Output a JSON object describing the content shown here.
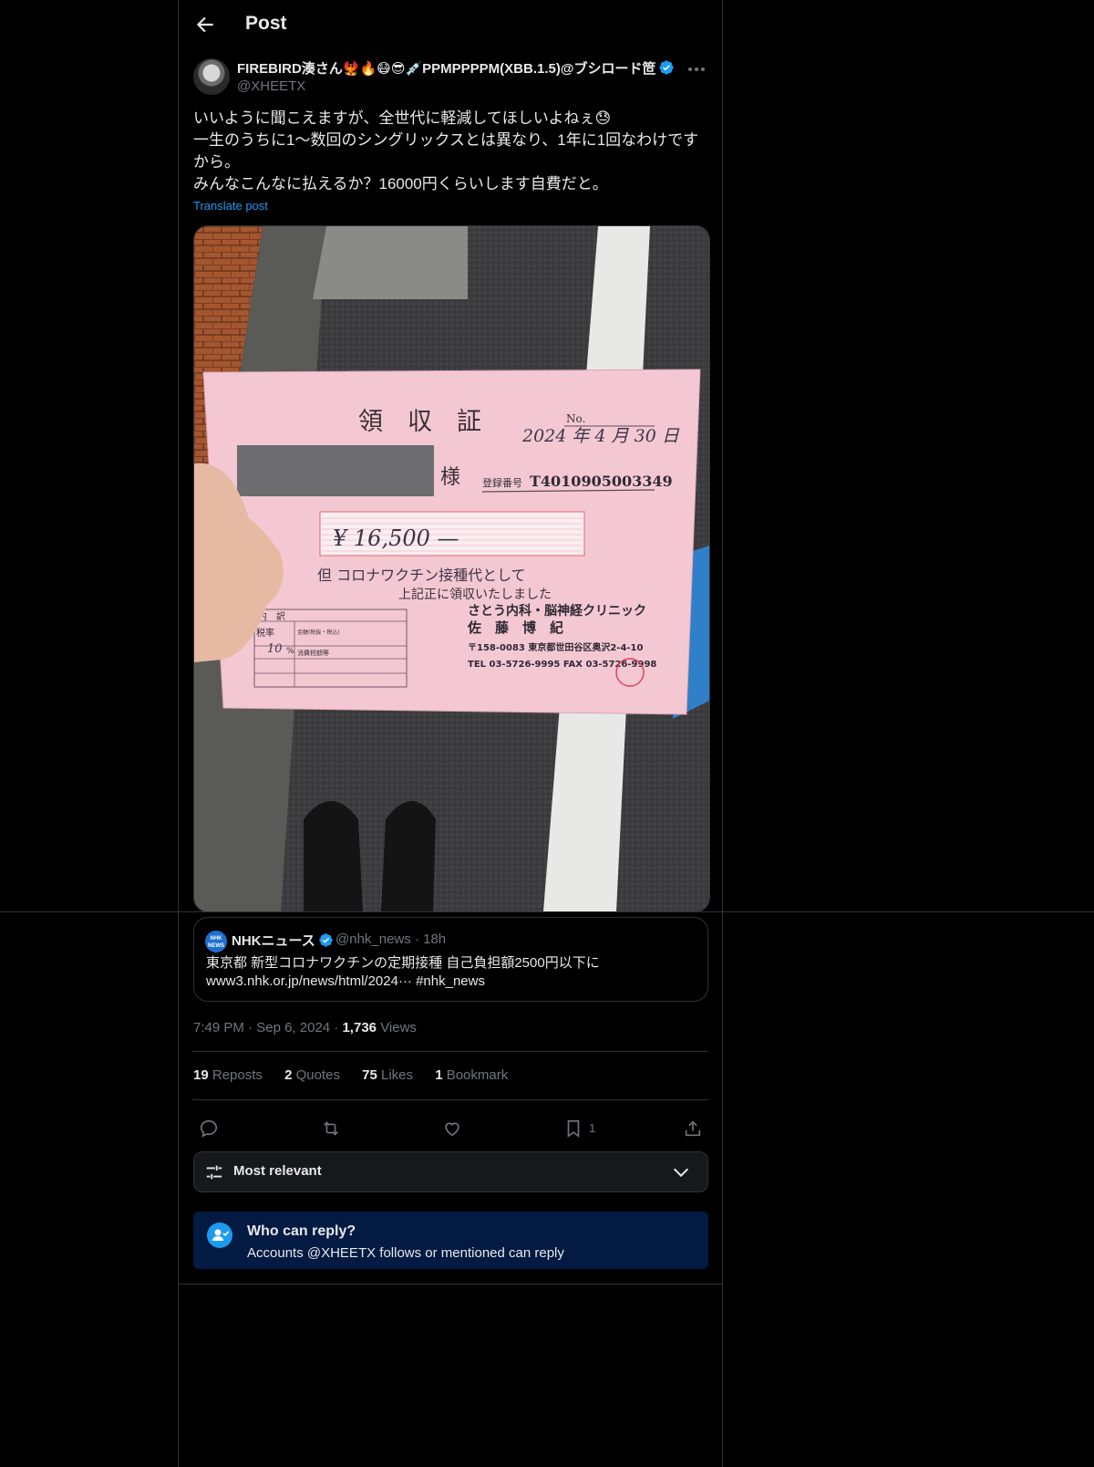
{
  "header": {
    "title": "Post"
  },
  "author": {
    "name": "FIREBIRD湊さん🐦‍🔥🔥😷😎💉PPMPPPPM(XBB.1.5)@ブシロード笸",
    "handle": "@XHEETX"
  },
  "post": {
    "lines": [
      "いいように聞こえますが、全世代に軽減してほしいよねぇ😓",
      "一生のうちに1〜数回のシングリックスとは異なり、1年に1回なわけです\nから。",
      "みんなこんなに払えるか？16000円くらいします自費だと。"
    ],
    "translate_label": "Translate post"
  },
  "receipt": {
    "title": "領　収　証",
    "no_label": "No.",
    "date": "2024 年 4 月 30 日",
    "sama": "様",
    "reg_label": "登録番号",
    "reg_number": "T4010905003349",
    "amount": "¥ 16,500 —",
    "purpose": "但 コロナワクチン接種代として",
    "received": "上記正に領収いたしました",
    "breakdown_label": "内　訳",
    "tax_rate_label": "税率",
    "tax_rate_value": "10",
    "percent": "%",
    "amount_label": "金額(税抜・税込)",
    "tax_amount_label": "消費税額等",
    "clinic_name": "さとう内科・脳神経クリニック",
    "doctor_name": "佐　藤　博　紀",
    "address": "〒158-0083 東京都世田谷区奥沢2-4-10",
    "phone": "TEL 03-5726-9995 FAX 03-5726-9998"
  },
  "quote": {
    "name": "NHKニュース",
    "handle": "@nhk_news · 18h",
    "logo_top": "NHK",
    "logo_bottom": "NEWS",
    "line1": "東京都 新型コロナワクチンの定期接種 自己負担額2500円以下に",
    "line2": "www3.nhk.or.jp/news/html/2024··· #nhk_news"
  },
  "meta": {
    "time": "7:49 PM",
    "date": "Sep 6, 2024",
    "views_count": "1,736",
    "views_label": "Views",
    "sep": "·"
  },
  "stats": [
    {
      "count": "19",
      "label": "Reposts"
    },
    {
      "count": "2",
      "label": "Quotes"
    },
    {
      "count": "75",
      "label": "Likes"
    },
    {
      "count": "1",
      "label": "Bookmark"
    }
  ],
  "actions": {
    "bookmark_count": "1",
    "icons": [
      "reply-icon",
      "repost-icon",
      "like-icon",
      "bookmark-icon",
      "share-icon"
    ]
  },
  "sort": {
    "label": "Most relevant"
  },
  "reply_restriction": {
    "title": "Who can reply?",
    "subtitle": "Accounts @XHEETX follows or mentioned can reply"
  },
  "colors": {
    "background": "#000000",
    "text": "#e7e9ea",
    "muted": "#71767b",
    "accent": "#1d9bf0",
    "border": "#2f3336",
    "reply_box": "#031a42"
  }
}
